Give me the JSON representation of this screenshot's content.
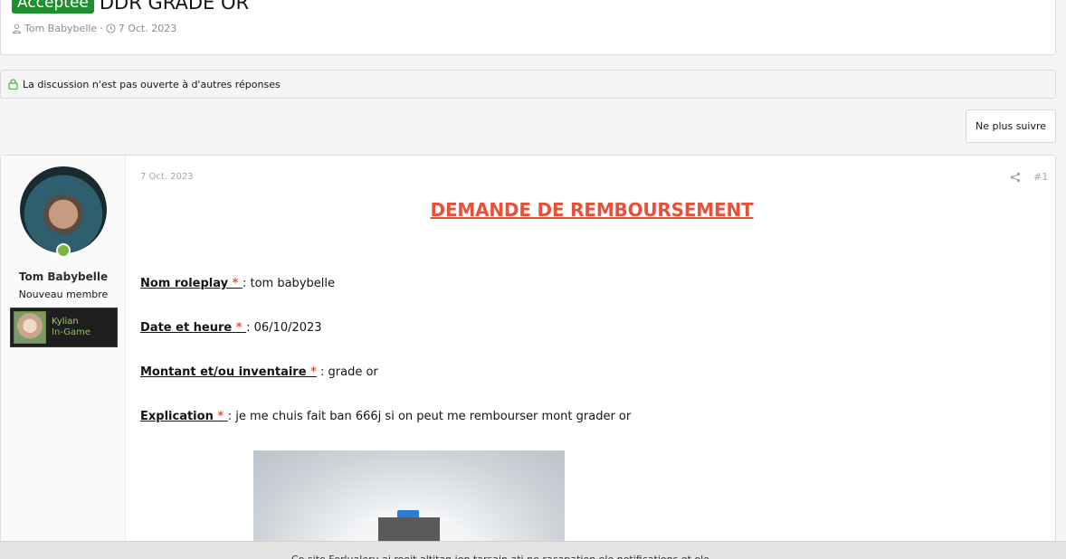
{
  "thread": {
    "badge": "Acceptée",
    "title": "DDR GRADE OR",
    "author": "Tom Babybelle",
    "separator": "·",
    "date": "7 Oct. 2023"
  },
  "locked_notice": "La discussion n'est pas ouverte à d'autres réponses",
  "follow_button": "Ne plus suivre",
  "post": {
    "user": {
      "name": "Tom Babybelle",
      "title": "Nouveau membre",
      "game_card": {
        "name": "Kylian",
        "status": "In-Game"
      }
    },
    "date": "7 Oct. 2023",
    "number": "#1",
    "heading": "DEMANDE DE REMBOURSEMENT",
    "fields": [
      {
        "label": "Nom roleplay",
        "req": "*",
        "value": " : tom babybelle"
      },
      {
        "label": "Date et heure",
        "req": "*",
        "value": ": 06/10/2023"
      },
      {
        "label": "Montant et/ou inventaire",
        "req": "*",
        "value": " : grade or"
      },
      {
        "label": "Explication",
        "req": "*",
        "value": ": je me chuis fait ban 666j si on peut me rembourser mont grader or"
      }
    ]
  },
  "cookie_notice": "Ce site Forlualeru ai rooit altitan ion tarsain ati ne racapation ole notifications et ole",
  "colors": {
    "accent": "#e5513a",
    "badge": "#1d8f2c",
    "online": "#7cb342"
  },
  "icons": [
    "user-icon",
    "clock-icon",
    "lock-icon",
    "share-icon"
  ]
}
